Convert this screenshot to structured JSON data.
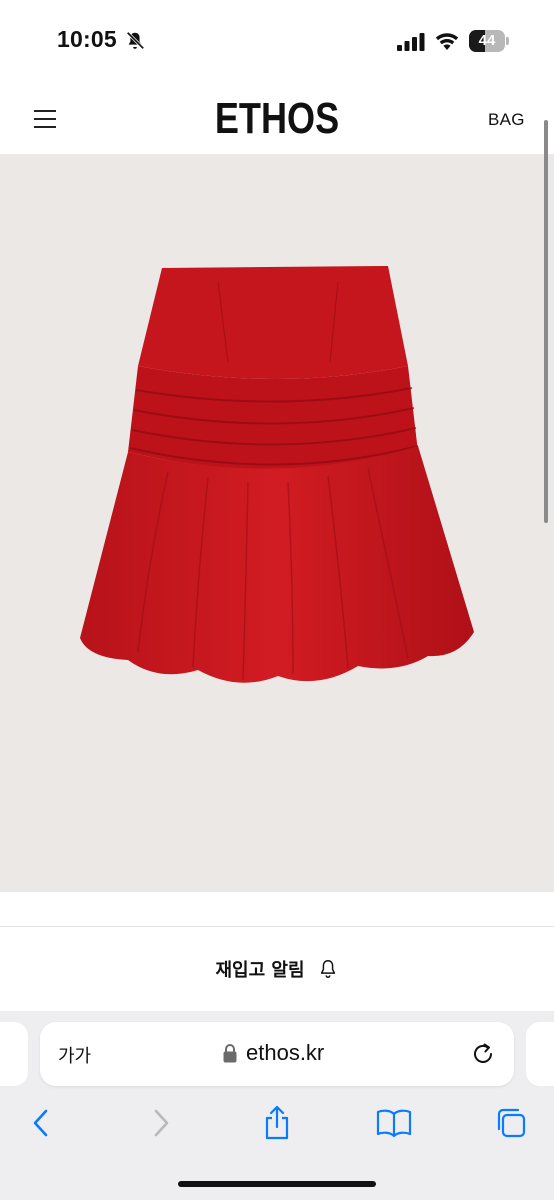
{
  "status_bar": {
    "time": "10:05",
    "battery_level": "44",
    "battery_fraction": 0.44,
    "icons": [
      "bell-slash-icon",
      "signal-icon",
      "wifi-icon",
      "battery-icon"
    ]
  },
  "header": {
    "brand": "ETHOS",
    "bag_label": "BAG",
    "menu_icon": "hamburger-menu-icon"
  },
  "product": {
    "image_subject": "red-ruffled-skirt",
    "image_background": "#ebe8e6",
    "accent": "#c8161d"
  },
  "restock": {
    "label": "재입고 알림",
    "icon": "bell-icon"
  },
  "browser": {
    "text_size_label": "가가",
    "url": "ethos.kr",
    "icons": [
      "lock-icon",
      "reload-icon",
      "back-icon",
      "forward-icon",
      "share-icon",
      "bookmarks-icon",
      "tabs-icon"
    ],
    "accent": "#0a7aff"
  }
}
